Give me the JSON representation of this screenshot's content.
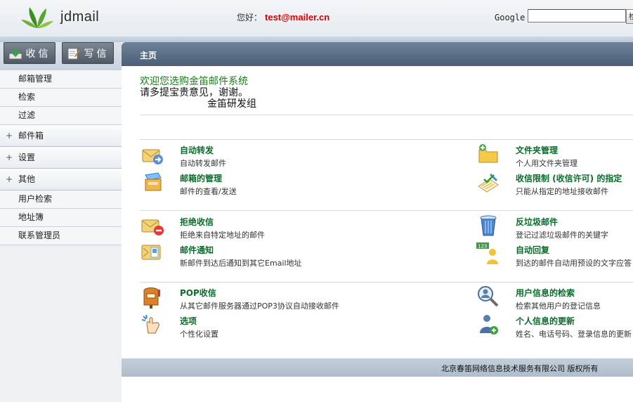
{
  "header": {
    "logo_text": "jdmail",
    "greeting": "您好：",
    "user_email": "test@mailer.cn",
    "google_label": "Google",
    "google_input_value": "",
    "google_button_label": "检索"
  },
  "sidebar": {
    "receive_label": "收信",
    "compose_label": "写信",
    "menu": [
      {
        "label": "邮箱管理"
      },
      {
        "label": "检索"
      },
      {
        "label": "过滤"
      },
      {
        "label": "邮件箱"
      },
      {
        "label": "设置"
      },
      {
        "label": "其他"
      },
      {
        "label": "用户检索"
      },
      {
        "label": "地址簿"
      },
      {
        "label": "联系管理员"
      }
    ]
  },
  "main": {
    "section_title": "主页",
    "welcome_line1": "欢迎您选购金笛邮件系统",
    "welcome_line2": "请多提宝贵意见，谢谢。",
    "welcome_line3": "金笛研发组",
    "features": [
      {
        "title": "自动转发",
        "desc": "自动转发邮件",
        "icon": "mail-forward-icon"
      },
      {
        "title": "文件夹管理",
        "desc": "个人用文件夹管理",
        "icon": "folder-manage-icon"
      },
      {
        "title": "邮箱的管理",
        "desc": "邮件的查看/发送",
        "icon": "mailbox-manage-icon"
      },
      {
        "title": "收信限制 (收信许可) 的指定",
        "desc": "只能从指定的地址接收邮件",
        "icon": "receive-limit-icon"
      },
      {
        "title": "拒绝收信",
        "desc": "拒绝来自特定地址的邮件",
        "icon": "reject-mail-icon"
      },
      {
        "title": "反垃圾邮件",
        "desc": "登记过滤垃圾邮件的关键字",
        "icon": "trash-icon"
      },
      {
        "title": "邮件通知",
        "desc": "新邮件到达后通知到其它Email地址",
        "icon": "mail-notify-icon"
      },
      {
        "title": "自动回复",
        "desc": "到达的邮件自动用预设的文字应答",
        "icon": "auto-reply-icon"
      },
      {
        "title": "POP收信",
        "desc": "从其它邮件服务器通过POP3协议自动接收邮件",
        "icon": "pop-mailbox-icon"
      },
      {
        "title": "用户信息的检索",
        "desc": "检索其他用户的登记信息",
        "icon": "user-search-icon"
      },
      {
        "title": "选项",
        "desc": "个性化设置",
        "icon": "options-hand-icon"
      },
      {
        "title": "个人信息的更新",
        "desc": "姓名、电话号码、登录信息的更新",
        "icon": "user-update-icon"
      }
    ]
  },
  "footer": {
    "copyright": "北京春笛网络信息技术服务有限公司 版权所有"
  },
  "colors": {
    "accent_green": "#0b6b2b",
    "email_red": "#d40000",
    "header_blue": "#4a5f76"
  }
}
